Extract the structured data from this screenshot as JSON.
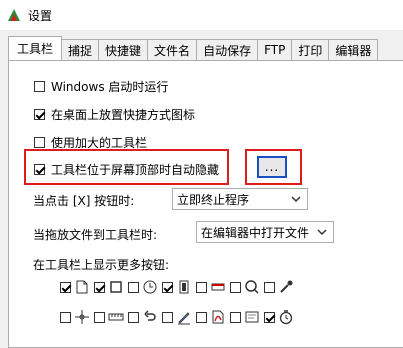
{
  "window": {
    "title": "设置"
  },
  "tabs": [
    "工具栏",
    "捕捉",
    "快捷键",
    "文件名",
    "自动保存",
    "FTP",
    "打印",
    "编辑器"
  ],
  "options": {
    "windows_startup": "Windows 启动时运行",
    "desktop_shortcut": "在桌面上放置快捷方式图标",
    "large_toolbar": "使用加大的工具栏",
    "auto_hide": "工具栏位于屏幕顶部时自动隐藏"
  },
  "more_button": "...",
  "click_label": "当点击 [X] 按钮时:",
  "click_select": "立即终止程序",
  "drop_label": "当拖放文件到工具栏时:",
  "drop_select": "在编辑器中打开文件",
  "more_buttons_label": "在工具栏上显示更多按钮:",
  "colors": {
    "highlight": "#e01b1b",
    "button_border": "#1b4fc4"
  },
  "icon_buttons": [
    [
      {
        "name": "new-icon",
        "checked": true
      },
      {
        "name": "rectangle-icon",
        "checked": true
      },
      {
        "name": "clock-icon",
        "checked": false
      },
      {
        "name": "film-icon",
        "checked": true
      },
      {
        "name": "window-icon",
        "checked": false
      },
      {
        "name": "magnifier-icon",
        "checked": false
      },
      {
        "name": "eyedropper-icon",
        "checked": false
      }
    ],
    [
      {
        "name": "crosshair-icon",
        "checked": false
      },
      {
        "name": "ruler-icon",
        "checked": false
      },
      {
        "name": "undo-icon",
        "checked": false
      },
      {
        "name": "edit-icon",
        "checked": false
      },
      {
        "name": "pdf-icon",
        "checked": false
      },
      {
        "name": "sticky-note-icon",
        "checked": false
      },
      {
        "name": "timer-icon",
        "checked": true
      }
    ]
  ]
}
